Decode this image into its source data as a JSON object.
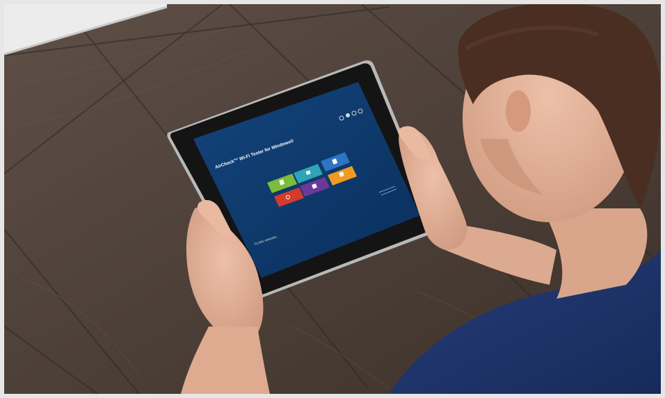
{
  "photo": {
    "subject": "person holding tablet over wooden table",
    "colors": {
      "wood": "#5a4a40",
      "wood_dark": "#3e322b",
      "tablet_bezel": "#141414",
      "tablet_frame": "#b8b8b8",
      "screen_bg": "#0e3a6e",
      "shirt": "#1f3268",
      "skin": "#e2b19a",
      "hair": "#4a2e22"
    }
  },
  "app_screen": {
    "title": "AirCheck™ Wi-Fi Tester for Windows®",
    "brand_logo": "FLUKE networks",
    "header_icons": [
      "settings-icon",
      "help-icon",
      "info-icon",
      "close-icon"
    ],
    "tiles": [
      {
        "name": "tile-green",
        "color": "#7dbb3a",
        "icon": "doc-icon"
      },
      {
        "name": "tile-teal",
        "color": "#2fa3b8",
        "icon": "network-icon"
      },
      {
        "name": "tile-blue",
        "color": "#2d74c2",
        "icon": "file-icon"
      },
      {
        "name": "tile-red",
        "color": "#d53a2e",
        "icon": "search-icon"
      },
      {
        "name": "tile-purple",
        "color": "#6a3a9a",
        "icon": "chart-icon"
      },
      {
        "name": "tile-orange",
        "color": "#f09a22",
        "icon": "check-icon"
      }
    ]
  }
}
